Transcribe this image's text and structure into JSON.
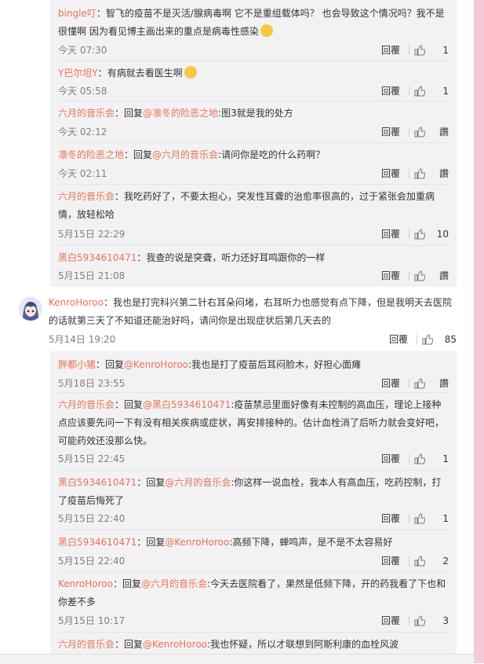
{
  "colors": {
    "username": "#eb7350",
    "meta": "#808080",
    "sub_bg": "#f2f2f5",
    "pink": "#f5c9d6"
  },
  "icons": {
    "like": "thumbs-up-icon",
    "avatar": "anime-girl-avatar"
  },
  "reply_label": "回覆",
  "top_replies": [
    {
      "user": "bingle叮",
      "sep": "：",
      "body": "智飞的疫苗不是灭活/腺病毒啊 它不是重组载体吗？ 也会导致这个情况吗？我不是很懂啊 因为看见博主画出来的重点是病毒性感染",
      "time": "今天 07:30",
      "likes": "1"
    },
    {
      "user": "Y巴尔坦Y",
      "sep": "：",
      "body": "有病就去看医生啊",
      "time": "今天 05:58",
      "likes": "1"
    },
    {
      "user": "六月的音乐会",
      "sep": "：回复",
      "mention": "@凛冬的险恶之地",
      "body": ":图3就是我的处方",
      "time": "今天 02:12",
      "likes": "讚"
    },
    {
      "user": "凛冬的险恶之地",
      "sep": "：回复",
      "mention": "@六月的音乐会",
      "body": ":请问你是吃的什么药啊？",
      "time": "今天 02:11",
      "likes": "讚"
    },
    {
      "user": "六月的音乐会",
      "sep": "：",
      "body": "我吃药好了，不要太担心，突发性耳聋的治愈率很高的，过于紧张会加重病情，放轻松哈",
      "time": "5月15日 22:29",
      "likes": "10"
    },
    {
      "user": "黑白5934610471",
      "sep": "：",
      "body": "我查的说是突聋，听力还好耳鸣跟你的一样",
      "time": "5月15日 21:08",
      "likes": "讚"
    }
  ],
  "main_comment": {
    "user": "KenroHoroo",
    "body": "：我也是打完科兴第二针右耳朵闷堵，右耳听力也感觉有点下降，但是我明天去医院的话就第三天了不知道还能治好吗，请问你是出现症状后第几天去的",
    "time": "5月14日 19:20",
    "likes": "85"
  },
  "bottom_replies": [
    {
      "user": "胖都小猪",
      "sep": "：回复",
      "mention": "@KenroHoroo",
      "body": ":我也是打了疫苗后耳闷脸木，好担心面瘫",
      "time": "5月18日 23:55",
      "likes": "讚"
    },
    {
      "user": "六月的音乐会",
      "sep": "：回复",
      "mention": "@黑白5934610471",
      "body": ":疫苗禁忌里面好像有未控制的高血压，理论上接种点应该要先问一下有没有相关疾病或症状，再安排接种的。估计血栓消了后听力就会变好吧，可能药效还没那么快。",
      "time": "5月15日 22:45",
      "likes": "1"
    },
    {
      "user": "黑白5934610471",
      "sep": "：回复",
      "mention": "@六月的音乐会",
      "body": ":你这样一说血栓，我本人有高血压，吃药控制，打了疫苗后悔死了",
      "time": "5月15日 22:40",
      "likes": "1"
    },
    {
      "user": "黑白5934610471",
      "sep": "：回复",
      "mention": "@KenroHoroo",
      "body": ":高频下降，蝉鸣声，是不是不太容易好",
      "time": "5月15日 22:40",
      "likes": "2"
    },
    {
      "user": "KenroHoroo",
      "sep": "：回复",
      "mention": "@六月的音乐会",
      "body": ":今天去医院看了，果然是低频下降，开的药我看了下也和你差不多",
      "time": "5月15日 10:17",
      "likes": "3"
    },
    {
      "user": "六月的音乐会",
      "sep": "：回复",
      "mention": "@KenroHoroo",
      "body": ":我也怀疑，所以才联想到阿斯利康的血栓风波",
      "time": "",
      "likes": ""
    }
  ]
}
